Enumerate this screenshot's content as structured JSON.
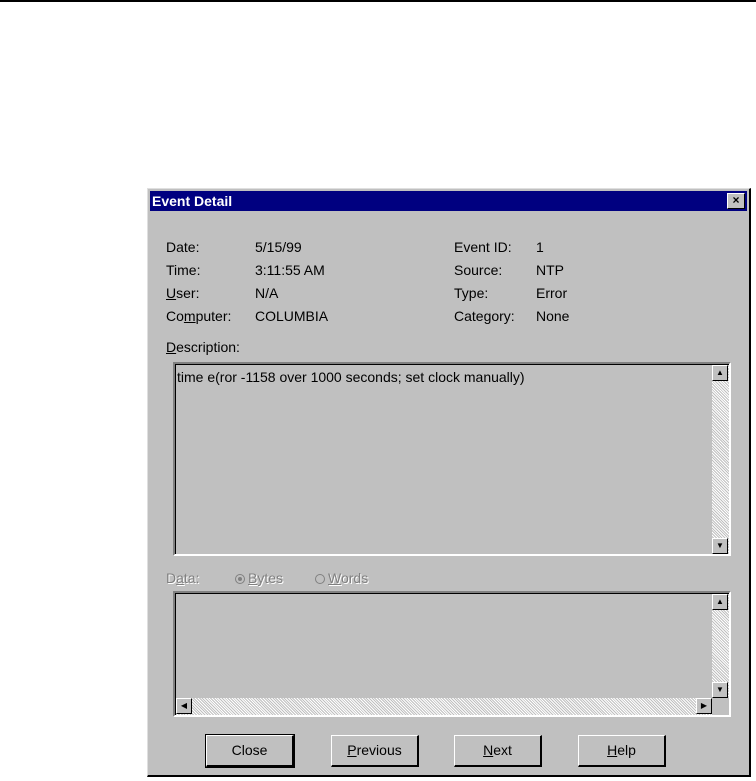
{
  "dialog": {
    "title": "Event Detail",
    "close_glyph": "×"
  },
  "fields": {
    "date_label": "Date:",
    "date_value": "5/15/99",
    "time_label": "Time:",
    "time_value": "3:11:55 AM",
    "user_label_first": "U",
    "user_label_rest": "ser:",
    "user_value": "N/A",
    "computer_label_a": "Co",
    "computer_label_u": "m",
    "computer_label_b": "puter:",
    "computer_value": "COLUMBIA",
    "eventid_label": "Event ID:",
    "eventid_value": "1",
    "source_label": "Source:",
    "source_value": "NTP",
    "type_label": "Type:",
    "type_value": "Error",
    "category_label": "Category:",
    "category_value": "None"
  },
  "description": {
    "label_first": "D",
    "label_rest": "escription:",
    "text": "time e(ror -1158 over 1000 seconds; set clock manually)"
  },
  "data_section": {
    "label_a": "D",
    "label_u": "a",
    "label_b": "ta:",
    "bytes_u": "B",
    "bytes_rest": "ytes",
    "words_u": "W",
    "words_rest": "ords",
    "selected": "bytes"
  },
  "buttons": {
    "close": "Close",
    "previous_u": "P",
    "previous_rest": "revious",
    "next_u": "N",
    "next_rest": "ext",
    "help_u": "H",
    "help_rest": "elp"
  },
  "icons": {
    "scroll_up": "▲",
    "scroll_down": "▼",
    "scroll_left": "◀",
    "scroll_right": "▶"
  }
}
